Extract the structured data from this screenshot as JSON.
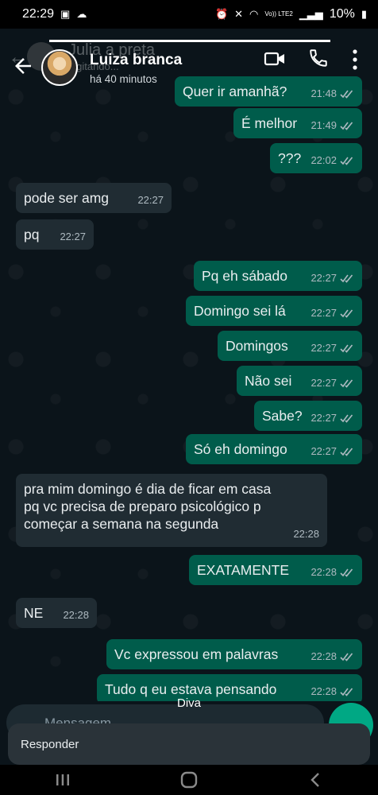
{
  "status_bar": {
    "time": "22:29",
    "battery": "10%",
    "carrier_tag": "Vo)) LTE2"
  },
  "ghost_header": {
    "name": "Julia a preta",
    "subtitle": "digitando..."
  },
  "header": {
    "contact_name": "Luiza branca",
    "last_seen": "há 40 minutos"
  },
  "messages": [
    {
      "dir": "out",
      "text": "Quer ir amanhã?",
      "time": "21:48"
    },
    {
      "dir": "out",
      "text": "É melhor",
      "time": "21:49"
    },
    {
      "dir": "out",
      "text": "???",
      "time": "22:02"
    },
    {
      "dir": "in",
      "text": "pode ser amg",
      "time": "22:27"
    },
    {
      "dir": "in",
      "text": "pq",
      "time": "22:27"
    },
    {
      "dir": "out",
      "text": "Pq eh sábado",
      "time": "22:27"
    },
    {
      "dir": "out",
      "text": "Domingo sei lá",
      "time": "22:27"
    },
    {
      "dir": "out",
      "text": "Domingos",
      "time": "22:27"
    },
    {
      "dir": "out",
      "text": "Não sei",
      "time": "22:27"
    },
    {
      "dir": "out",
      "text": "Sabe?",
      "time": "22:27"
    },
    {
      "dir": "out",
      "text": "Só eh domingo",
      "time": "22:27"
    },
    {
      "dir": "in",
      "text": "pra mim domingo é dia de ficar em casa\npq vc precisa de preparo psicológico p\ncomeçar a semana na segunda",
      "time": "22:28"
    },
    {
      "dir": "out",
      "text": "EXATAMENTE",
      "time": "22:28"
    },
    {
      "dir": "in",
      "text": "NE",
      "time": "22:28"
    },
    {
      "dir": "out",
      "text": "Vc expressou em palavras",
      "time": "22:28"
    },
    {
      "dir": "out",
      "text": "Tudo q eu estava pensando",
      "time": "22:28"
    }
  ],
  "reply_overlay": {
    "name": "Diva",
    "composer_placeholder": "Mensagem",
    "reply_label": "Responder"
  },
  "colors": {
    "background": "#0b141a",
    "outgoing_bubble": "#005c4b",
    "incoming_bubble": "#202c33",
    "accent": "#00a884",
    "read_ticks": "#aebac1"
  }
}
